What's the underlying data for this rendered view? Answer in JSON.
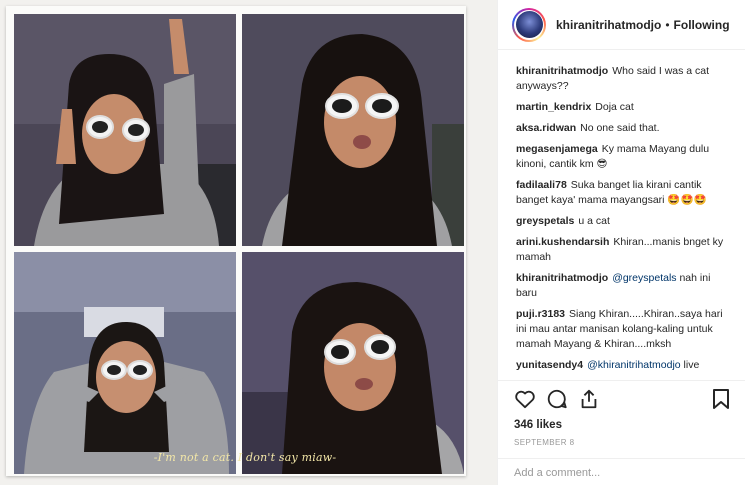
{
  "post": {
    "username": "khiranitrihatmodjo",
    "separator": "•",
    "follow_status": "Following",
    "image_caption_text": "-I'm not a cat. I don't say miaw-",
    "comments": [
      {
        "user": "khiranitrihatmodjo",
        "text": "Who said I was a cat anyways??"
      },
      {
        "user": "martin_kendrix",
        "text": "Doja cat"
      },
      {
        "user": "aksa.ridwan",
        "text": "No one said that."
      },
      {
        "user": "megasenjamega",
        "text": "Ky mama Mayang dulu kinoni, cantik km 😎"
      },
      {
        "user": "fadilaali78",
        "text": "Suka banget lia kirani cantik banget kaya' mama mayangsari 🤩🤩🤩"
      },
      {
        "user": "greyspetals",
        "text": "u a cat"
      },
      {
        "user": "arini.kushendarsih",
        "text": "Khiran...manis bnget ky mamah"
      },
      {
        "user": "khiranitrihatmodjo",
        "mention": "@greyspetals",
        "text": " nah ini baru"
      },
      {
        "user": "puji.r3183",
        "text": "Siang Khiran.....Khiran..saya hari ini mau antar manisan kolang-kaling untuk mamah Mayang & Khiran....mksh"
      },
      {
        "user": "yunitasendy4",
        "mention": "@khiranitrihatmodjo",
        "text": " live"
      }
    ],
    "likes": "346 likes",
    "date": "SEPTEMBER 8",
    "add_comment_placeholder": "Add a comment..."
  },
  "icons": {
    "like": "heart-icon",
    "comment": "comment-icon",
    "share": "share-icon",
    "save": "bookmark-icon"
  },
  "colors": {
    "mention": "#003569",
    "muted": "#999999",
    "caption_overlay": "#f3e7a8"
  }
}
